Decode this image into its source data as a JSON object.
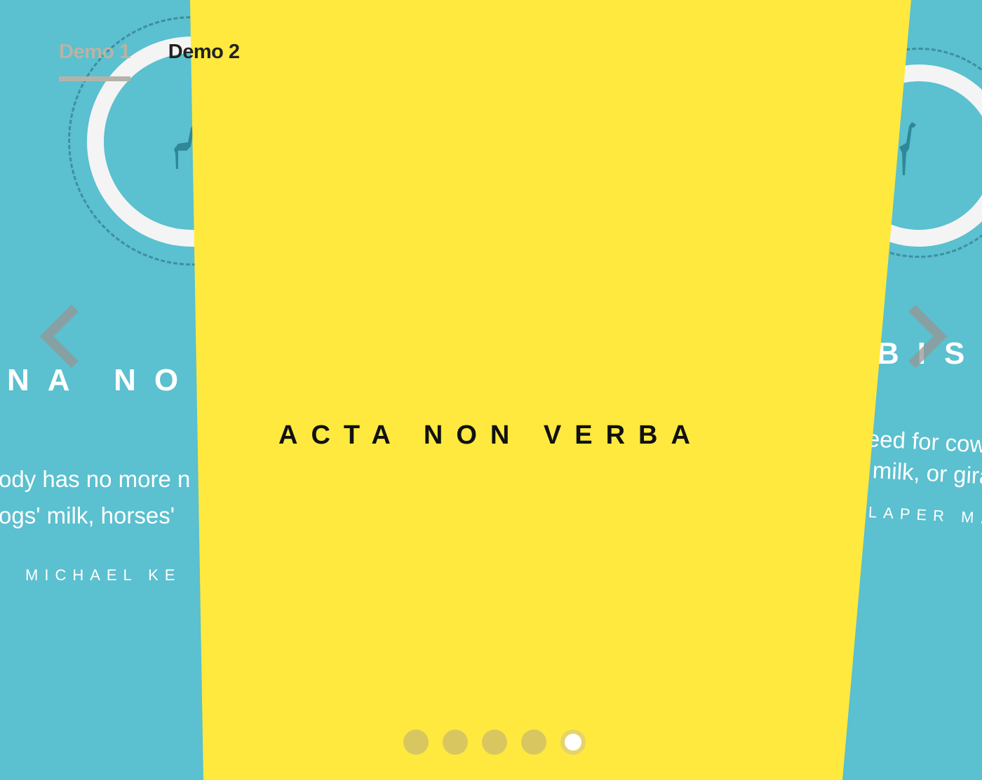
{
  "tabs": [
    {
      "label": "Demo 1",
      "active": true
    },
    {
      "label": "Demo 2",
      "active": false
    }
  ],
  "left_slide": {
    "title": "NA NO",
    "quote_line1": "ody has no more n",
    "quote_line2": "ogs' milk, horses'",
    "author": "MICHAEL KE"
  },
  "right_slide": {
    "title": "BIS",
    "quote_line1": "eed for cow",
    "quote_line2": "milk, or gira",
    "author": "LAPER M."
  },
  "center_slide": {
    "title": "ACTA NON VERBA",
    "background": "#ffe93f"
  },
  "carousel": {
    "slide_count": 5,
    "active_index": 4
  },
  "colors": {
    "page_background": "#5bc0cf",
    "accent_yellow": "#ffe93f"
  },
  "icons": {
    "prev": "chevron-left-icon",
    "next": "chevron-right-icon",
    "animal": "giraffe-icon"
  }
}
